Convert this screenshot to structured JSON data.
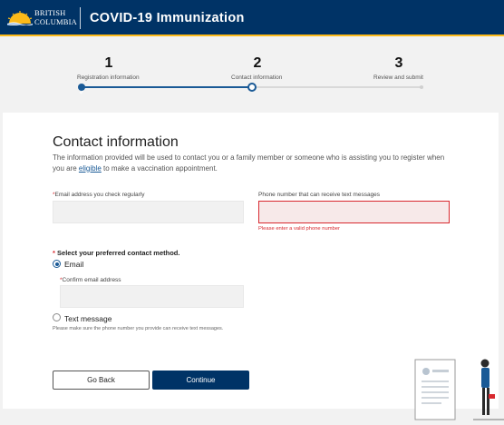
{
  "header": {
    "logo_line1": "BRITISH",
    "logo_line2": "COLUMBIA",
    "title": "COVID-19 Immunization"
  },
  "stepper": {
    "steps": [
      {
        "number": "1",
        "label": "Registration information",
        "state": "completed"
      },
      {
        "number": "2",
        "label": "Contact information",
        "state": "current"
      },
      {
        "number": "3",
        "label": "Review and submit",
        "state": "upcoming"
      }
    ]
  },
  "form": {
    "heading": "Contact information",
    "intro_before": "The information provided will be used to contact you or a family member or someone who is assisting you to register when you are ",
    "intro_link": "eligible",
    "intro_after": " to make a vaccination appointment.",
    "email": {
      "required_mark": "*",
      "label": "Email address you check regularly",
      "value": ""
    },
    "phone": {
      "label": "Phone number that can receive text messages",
      "value": "",
      "error": "Please enter a valid phone number"
    },
    "contact_method": {
      "required_mark": "*",
      "title": "Select your preferred contact method.",
      "options": [
        {
          "label": "Email",
          "selected": true
        },
        {
          "label": "Text message",
          "selected": false
        }
      ],
      "confirm_email": {
        "required_mark": "*",
        "label": "Confirm email address",
        "value": ""
      },
      "text_note": "Please make sure the phone number you provide can receive text messages."
    },
    "buttons": {
      "back": "Go Back",
      "continue": "Continue"
    }
  },
  "colors": {
    "brand_blue": "#003366",
    "accent_gold": "#fcba19",
    "link_blue": "#1a5a96",
    "error_red": "#d8292f"
  }
}
